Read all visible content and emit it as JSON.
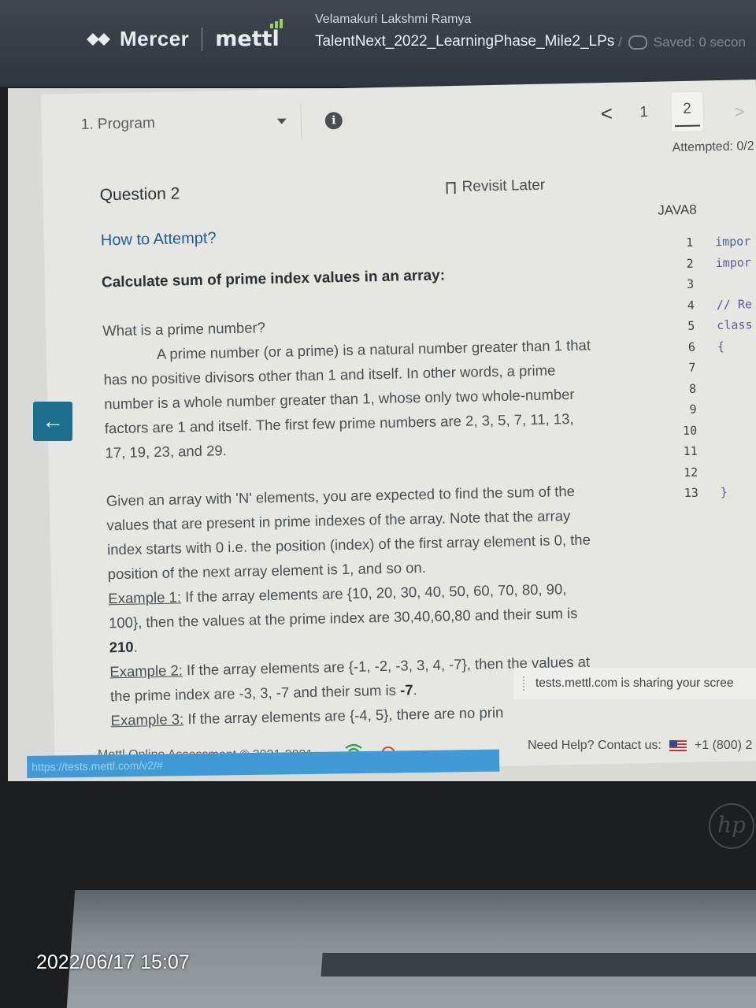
{
  "header": {
    "brand_primary": "Mercer",
    "brand_secondary": "mettl",
    "candidate_name": "Velamakuri Lakshmi Ramya",
    "test_name": "TalentNext_2022_LearningPhase_Mile2_LPs",
    "breadcrumb_sep": "/",
    "save_status": "Saved: 0 secon"
  },
  "toolbar": {
    "section_label": "1. Program",
    "prev_glyph": "<",
    "questions": [
      "1",
      "2"
    ],
    "active_question": "2",
    "next_glyph": ">",
    "attempted": "Attempted: 0/2"
  },
  "question": {
    "title": "Question 2",
    "revisit_label": "Revisit Later",
    "how_to_attempt": "How to Attempt?",
    "heading": "Calculate sum of prime index values in an array:",
    "prime_question": "What is a prime number?",
    "prime_definition": "A prime number (or a prime) is a natural number greater than 1 that has no positive divisors other than 1 and itself. In other words, a prime number is a whole number greater than 1, whose only two whole-number factors are 1 and itself.  The first few prime numbers are 2, 3, 5, 7, 11, 13, 17, 19, 23, and 29.",
    "task": "Given an array with 'N' elements, you are expected to find the sum of the values that are present in prime indexes of the array. Note that the array index starts with 0 i.e. the position (index) of the first array element is 0, the position of the next array element is 1, and so on.",
    "example1_label": "Example 1:",
    "example1_text": " If the array elements are {10, 20, 30, 40, 50, 60, 70, 80, 90, 100}, then the values at the prime index are 30,40,60,80 and their sum is ",
    "example1_result": "210",
    "example2_label": "Example 2:",
    "example2_text": " If the array elements are {-1, -2, -3, 3, 4, -7}, then the values at the prime index are -3, 3, -7 and their sum is ",
    "example2_result": "-7",
    "example3_label": "Example 3:",
    "example3_text": " If the array elements are {-4, 5}, there are no prin"
  },
  "editor": {
    "language": "JAVA8",
    "lines": [
      {
        "n": "1",
        "t": "impor"
      },
      {
        "n": "2",
        "t": "impor"
      },
      {
        "n": "3",
        "t": ""
      },
      {
        "n": "4",
        "t": "// Re"
      },
      {
        "n": "5",
        "t": "class"
      },
      {
        "n": "6",
        "t": "{"
      },
      {
        "n": "7",
        "t": ""
      },
      {
        "n": "8",
        "t": ""
      },
      {
        "n": "9",
        "t": ""
      },
      {
        "n": "10",
        "t": ""
      },
      {
        "n": "11",
        "t": ""
      },
      {
        "n": "12",
        "t": ""
      },
      {
        "n": "13",
        "t": "}"
      }
    ]
  },
  "share_notice": "tests.mettl.com is sharing your scree",
  "footer": {
    "copyright": "Mettl Online Assessment © 2021-2031",
    "help": "Need Help? Contact us:",
    "phone": "+1 (800) 2"
  },
  "url": "https://tests.mettl.com/v2/#",
  "back_glyph": "←",
  "hp_logo": "hp",
  "timestamp": "2022/06/17 15:07",
  "icons": [
    "mercer-logo-icon",
    "info-icon",
    "bookmark-icon",
    "cloud-icon",
    "wifi-icon",
    "record-icon",
    "us-flag-icon",
    "back-arrow-icon"
  ]
}
